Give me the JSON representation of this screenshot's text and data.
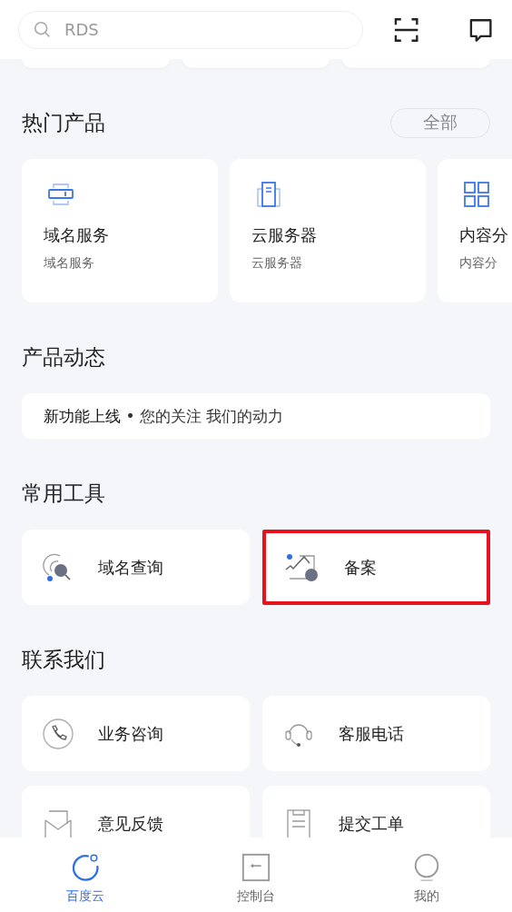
{
  "search": {
    "placeholder": "RDS"
  },
  "hot_products": {
    "title": "热门产品",
    "all_button": "全部",
    "items": [
      {
        "kind": "domain",
        "title": "域名服务",
        "subtitle": "域名服务"
      },
      {
        "kind": "server",
        "title": "云服务器",
        "subtitle": "云服务器"
      },
      {
        "kind": "grid",
        "title": "内容分",
        "subtitle": "内容分"
      }
    ]
  },
  "product_news": {
    "title": "产品动态",
    "headline": "新功能上线",
    "separator": "•",
    "text": "您的关注 我们的动力"
  },
  "tools": {
    "title": "常用工具",
    "items": [
      {
        "kind": "domain-search",
        "label": "域名查询",
        "highlighted": false
      },
      {
        "kind": "filing",
        "label": "备案",
        "highlighted": true
      }
    ]
  },
  "contact": {
    "title": "联系我们",
    "items": [
      {
        "kind": "phone",
        "label": "业务咨询"
      },
      {
        "kind": "headset",
        "label": "客服电话"
      },
      {
        "kind": "mail",
        "label": "意见反馈"
      },
      {
        "kind": "clipboard",
        "label": "提交工单"
      }
    ]
  },
  "tabs": [
    {
      "kind": "cloud",
      "label": "百度云",
      "selected": true
    },
    {
      "kind": "console",
      "label": "控制台",
      "selected": false
    },
    {
      "kind": "me",
      "label": "我的",
      "selected": false
    }
  ]
}
